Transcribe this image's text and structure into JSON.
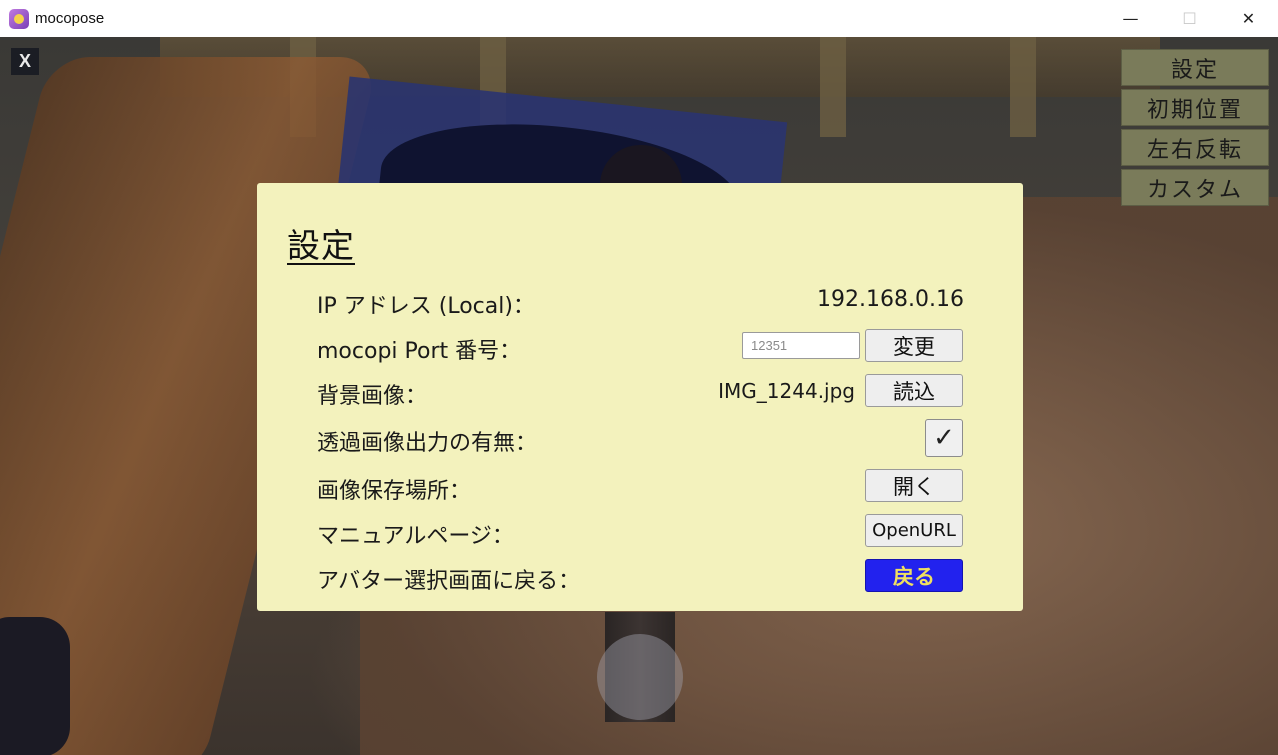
{
  "window": {
    "title": "mocopose",
    "minimize_glyph": "—",
    "maximize_glyph": "☐",
    "close_glyph": "✕"
  },
  "overlay": {
    "close_label": "X"
  },
  "side_menu": {
    "items": [
      {
        "label": "設定"
      },
      {
        "label": "初期位置"
      },
      {
        "label": "左右反転"
      },
      {
        "label": "カスタム"
      }
    ]
  },
  "settings": {
    "title": "設定",
    "ip": {
      "label": "IP アドレス (Local)：",
      "value": "192.168.0.16"
    },
    "port": {
      "label": "mocopi Port 番号：",
      "placeholder": "12351",
      "button": "変更"
    },
    "background": {
      "label": "背景画像：",
      "value": "IMG_1244.jpg",
      "button": "読込"
    },
    "transparent": {
      "label": "透過画像出力の有無：",
      "checked": true,
      "check_glyph": "✓"
    },
    "save_location": {
      "label": "画像保存場所：",
      "button": "開く"
    },
    "manual": {
      "label": "マニュアルページ：",
      "button": "OpenURL"
    },
    "back": {
      "label": "アバター選択画面に戻る：",
      "button": "戻る"
    }
  },
  "colors": {
    "dialog_bg": "#f3f2bd",
    "side_button_bg": "#7a7b5a",
    "primary_button_bg": "#2222ee",
    "primary_button_text": "#f0e060"
  }
}
